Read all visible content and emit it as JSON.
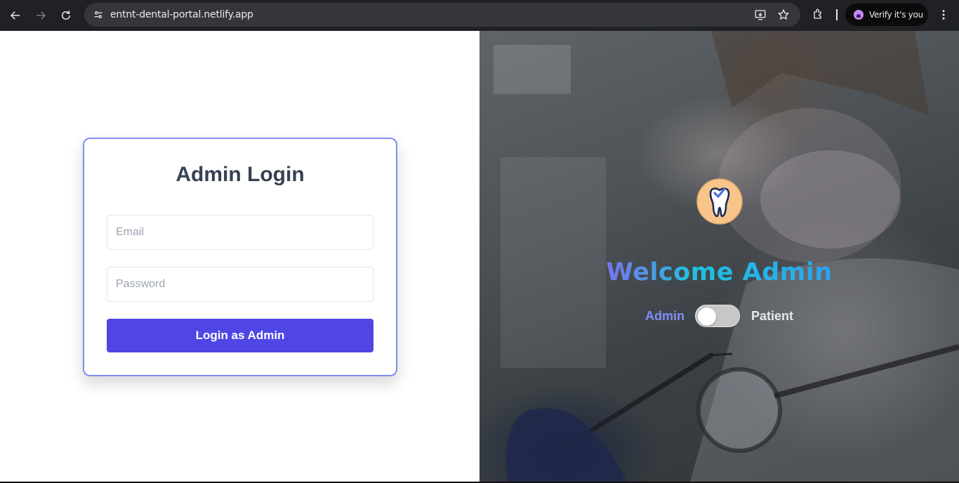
{
  "browser": {
    "url": "entnt-dental-portal.netlify.app",
    "profile_label": "Verify it's you"
  },
  "login": {
    "title": "Admin Login",
    "email_placeholder": "Email",
    "email_value": "",
    "password_placeholder": "Password",
    "password_value": "",
    "submit_label": "Login as Admin"
  },
  "welcome": {
    "heading": "Welcome Admin",
    "role_left": "Admin",
    "role_right": "Patient",
    "toggle_state": "off"
  },
  "colors": {
    "primary": "#4f46e5",
    "card_border": "#818cf8",
    "admin_label": "#818cf8"
  },
  "icons": [
    "back-arrow-icon",
    "forward-arrow-icon",
    "reload-icon",
    "site-info-icon",
    "install-app-icon",
    "bookmark-star-icon",
    "extensions-icon",
    "profile-avatar-icon",
    "more-menu-icon",
    "tooth-logo-icon"
  ]
}
